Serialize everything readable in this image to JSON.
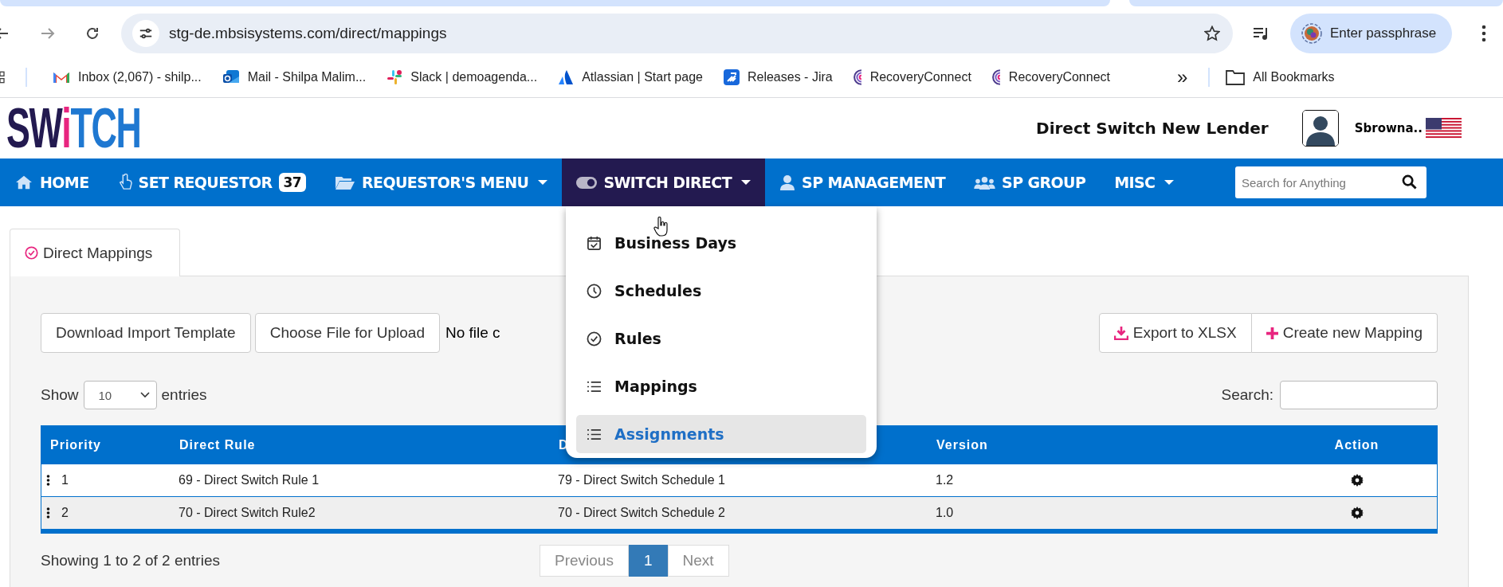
{
  "browser": {
    "url": "stg-de.mbsisystems.com/direct/mappings",
    "profile_button": "Enter passphrase",
    "bookmarks": [
      {
        "label": "Inbox (2,067) - shilp..."
      },
      {
        "label": "Mail - Shilpa Malim..."
      },
      {
        "label": "Slack | demoagenda..."
      },
      {
        "label": "Atlassian | Start page"
      },
      {
        "label": "Releases - Jira"
      },
      {
        "label": "RecoveryConnect"
      },
      {
        "label": "RecoveryConnect"
      }
    ],
    "overflow": "»",
    "all_bookmarks": "All Bookmarks"
  },
  "header": {
    "logo": [
      {
        "text": "SW",
        "color": "#231a50"
      },
      {
        "text": "i",
        "color": "#e8257f"
      },
      {
        "text": "TCH",
        "color": "#1f78d1"
      }
    ],
    "lender": "Direct Switch New Lender",
    "user": "Sbrowna.."
  },
  "nav": {
    "items": [
      {
        "label": "HOME",
        "has_menu": false,
        "selected": false
      },
      {
        "label": "SET REQUESTOR",
        "badge": "37",
        "has_menu": false,
        "selected": false
      },
      {
        "label": "REQUESTOR'S MENU",
        "has_menu": true,
        "selected": false
      },
      {
        "label": "SWITCH DIRECT",
        "has_menu": true,
        "selected": true
      },
      {
        "label": "SP MANAGEMENT",
        "has_menu": false,
        "selected": false
      },
      {
        "label": "SP GROUP",
        "has_menu": false,
        "selected": false
      },
      {
        "label": "MISC",
        "has_menu": true,
        "selected": false
      }
    ],
    "search": {
      "placeholder": "Search for Anything"
    }
  },
  "menu": {
    "items": [
      {
        "label": "Business Days",
        "selected": false
      },
      {
        "label": "Schedules",
        "selected": false
      },
      {
        "label": "Rules",
        "selected": false
      },
      {
        "label": "Mappings",
        "selected": false
      },
      {
        "label": "Assignments",
        "selected": true
      }
    ]
  },
  "tab": {
    "label": "Direct Mappings"
  },
  "toolbar": {
    "download": "Download Import Template",
    "choose_file": "Choose File for Upload",
    "file_status": "No file c",
    "export": "Export to XLSX",
    "create": "Create new Mapping"
  },
  "length": {
    "show": "Show",
    "value": "10",
    "entries": "entries"
  },
  "search_label": "Search:",
  "table": {
    "columns": [
      "Priority",
      "Direct Rule",
      "D",
      "Version",
      "Action"
    ],
    "rows": [
      {
        "priority": "1",
        "direct_rule": "69 - Direct Switch Rule 1",
        "column_3": "79 - Direct Switch Schedule 1",
        "version": "1.2"
      },
      {
        "priority": "2",
        "direct_rule": "70 - Direct Switch Rule2",
        "column_3": "70 - Direct Switch Schedule 2",
        "version": "1.0"
      }
    ]
  },
  "info": "Showing 1 to 2 of 2 entries",
  "pagination": {
    "previous": {
      "label": "Previous",
      "disabled": true
    },
    "pages": [
      {
        "label": "1",
        "selected": true
      }
    ],
    "next": {
      "label": "Next",
      "disabled": true
    }
  }
}
